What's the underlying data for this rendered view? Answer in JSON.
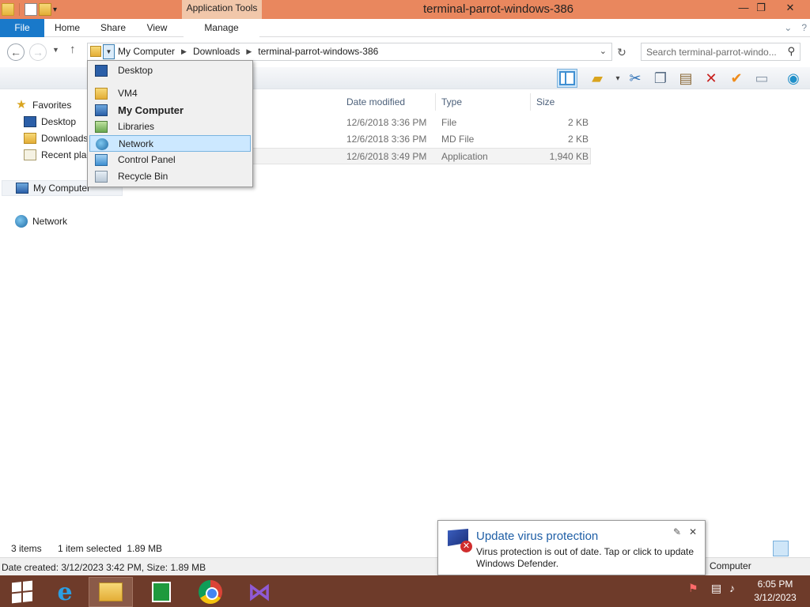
{
  "window": {
    "title": "terminal-parrot-windows-386",
    "context_tab": "Application Tools",
    "minimize": "—",
    "maximize": "❐",
    "close": "✕"
  },
  "ribbon": {
    "file": "File",
    "home": "Home",
    "share": "Share",
    "view": "View",
    "manage": "Manage",
    "collapse": "⌄",
    "help": "?"
  },
  "address": {
    "crumbs": [
      "My Computer",
      "Downloads",
      "terminal-parrot-windows-386"
    ],
    "search_placeholder": "Search terminal-parrot-windo..."
  },
  "dropdown": {
    "items": [
      {
        "label": "Desktop",
        "icon": "desktop-icon"
      },
      {
        "label": "VM4",
        "icon": "user-folder-icon"
      },
      {
        "label": "My Computer",
        "icon": "computer-icon"
      },
      {
        "label": "Libraries",
        "icon": "libraries-icon"
      },
      {
        "label": "Network",
        "icon": "network-icon"
      },
      {
        "label": "Control Panel",
        "icon": "control-panel-icon"
      },
      {
        "label": "Recycle Bin",
        "icon": "recycle-bin-icon"
      }
    ]
  },
  "navpane": {
    "favorites": "Favorites",
    "desktop": "Desktop",
    "downloads": "Downloads",
    "recent": "Recent plac",
    "computer": "My Computer",
    "network": "Network"
  },
  "filelist": {
    "columns": [
      "Date modified",
      "Type",
      "Size"
    ],
    "rows": [
      {
        "date": "12/6/2018 3:36 PM",
        "type": "File",
        "size": "2 KB"
      },
      {
        "date": "12/6/2018 3:36 PM",
        "type": "MD File",
        "size": "2 KB"
      },
      {
        "date": "12/6/2018 3:49 PM",
        "type": "Application",
        "size": "1,940 KB"
      }
    ]
  },
  "status": {
    "items": "3 items",
    "selected": "1 item selected  1.89 MB",
    "details": "Date created: 3/12/2023 3:42 PM, Size: 1.89 MB",
    "computer": "Computer"
  },
  "notification": {
    "title": "Update virus protection",
    "text": "Virus protection is out of date. Tap or click to update Windows Defender."
  },
  "clock": {
    "time": "6:05 PM",
    "date": "3/12/2023"
  },
  "colors": {
    "titlebar": "#e9875e",
    "file_tab": "#1979ca",
    "taskbar": "#6e3b2a",
    "highlight": "#cce8ff"
  }
}
